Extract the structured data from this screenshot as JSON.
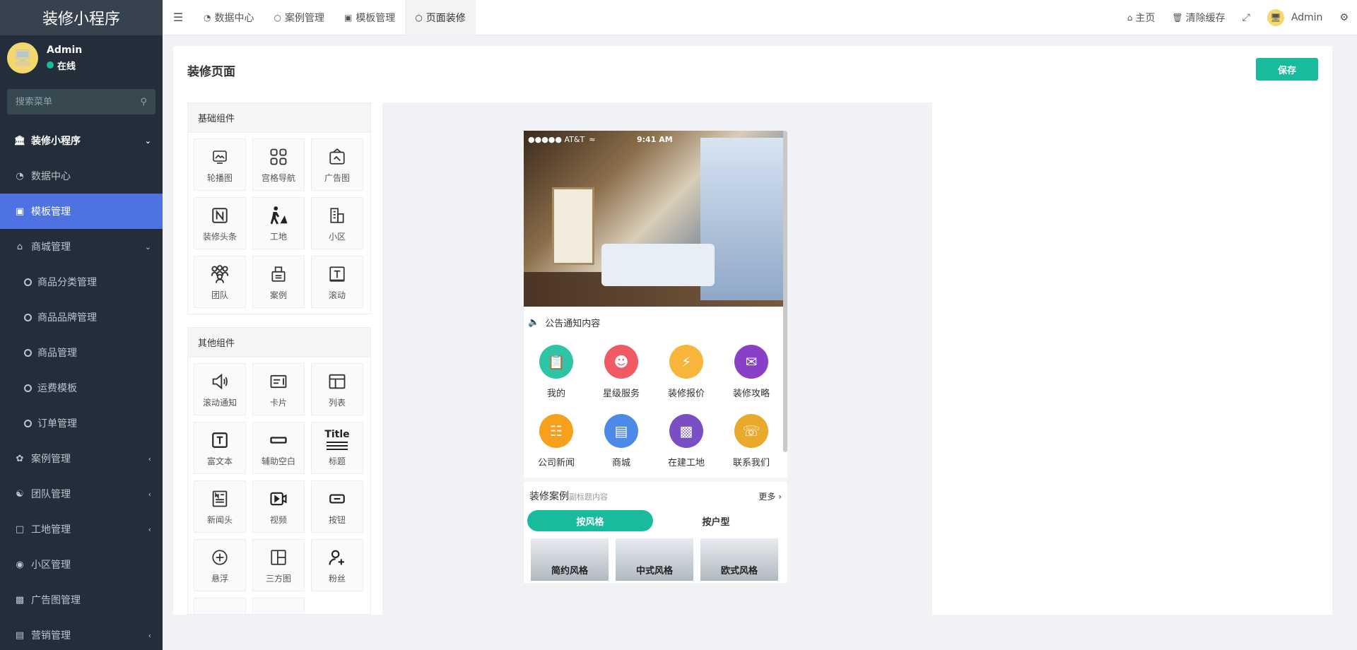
{
  "app": {
    "title": "装修小程序"
  },
  "user": {
    "name": "Admin",
    "status": "在线"
  },
  "search": {
    "placeholder": "搜索菜单"
  },
  "sidebar": {
    "header": "装修小程序",
    "items": [
      {
        "label": "数据中心"
      },
      {
        "label": "模板管理"
      },
      {
        "label": "商城管理"
      },
      {
        "label": "商品分类管理"
      },
      {
        "label": "商品品牌管理"
      },
      {
        "label": "商品管理"
      },
      {
        "label": "运费模板"
      },
      {
        "label": "订单管理"
      },
      {
        "label": "案例管理"
      },
      {
        "label": "团队管理"
      },
      {
        "label": "工地管理"
      },
      {
        "label": "小区管理"
      },
      {
        "label": "广告图管理"
      },
      {
        "label": "营销管理"
      }
    ]
  },
  "topbar": {
    "tabs": [
      {
        "label": "数据中心"
      },
      {
        "label": "案例管理"
      },
      {
        "label": "模板管理"
      },
      {
        "label": "页面装修"
      }
    ],
    "home": "主页",
    "clear_cache": "清除缓存",
    "user": "Admin"
  },
  "page": {
    "title": "装修页面",
    "save_label": "保存"
  },
  "basic_components": {
    "title": "基础组件",
    "items": [
      {
        "label": "轮播图"
      },
      {
        "label": "宫格导航"
      },
      {
        "label": "广告图"
      },
      {
        "label": "装修头条"
      },
      {
        "label": "工地"
      },
      {
        "label": "小区"
      },
      {
        "label": "团队"
      },
      {
        "label": "案例"
      },
      {
        "label": "滚动"
      }
    ]
  },
  "other_components": {
    "title": "其他组件",
    "items": [
      {
        "label": "滚动通知"
      },
      {
        "label": "卡片"
      },
      {
        "label": "列表"
      },
      {
        "label": "富文本"
      },
      {
        "label": "辅助空白"
      },
      {
        "label": "标题"
      },
      {
        "label": "新闻头"
      },
      {
        "label": "视频"
      },
      {
        "label": "按钮"
      },
      {
        "label": "悬浮"
      },
      {
        "label": "三方图"
      },
      {
        "label": "粉丝"
      }
    ],
    "title_icon_text": "Title"
  },
  "preview": {
    "statusbar": {
      "carrier": "●●●●● AT&T",
      "time": "9:41 AM"
    },
    "notice": "公告通知内容",
    "nav": [
      {
        "label": "我的",
        "color": "#2ec4a5"
      },
      {
        "label": "星级服务",
        "color": "#f05a64"
      },
      {
        "label": "装修报价",
        "color": "#f7b53a"
      },
      {
        "label": "装修攻略",
        "color": "#8a3fc8"
      },
      {
        "label": "公司新闻",
        "color": "#f7a01d"
      },
      {
        "label": "商城",
        "color": "#4d8ae8"
      },
      {
        "label": "在建工地",
        "color": "#7b4fc4"
      },
      {
        "label": "联系我们",
        "color": "#e9a92a"
      }
    ],
    "cases": {
      "title": "装修案例",
      "subtitle": "副标题内容",
      "more": "更多",
      "tabs": [
        {
          "label": "按风格"
        },
        {
          "label": "按户型"
        }
      ],
      "cards": [
        {
          "label": "简约风格"
        },
        {
          "label": "中式风格"
        },
        {
          "label": "欧式风格"
        }
      ]
    }
  }
}
